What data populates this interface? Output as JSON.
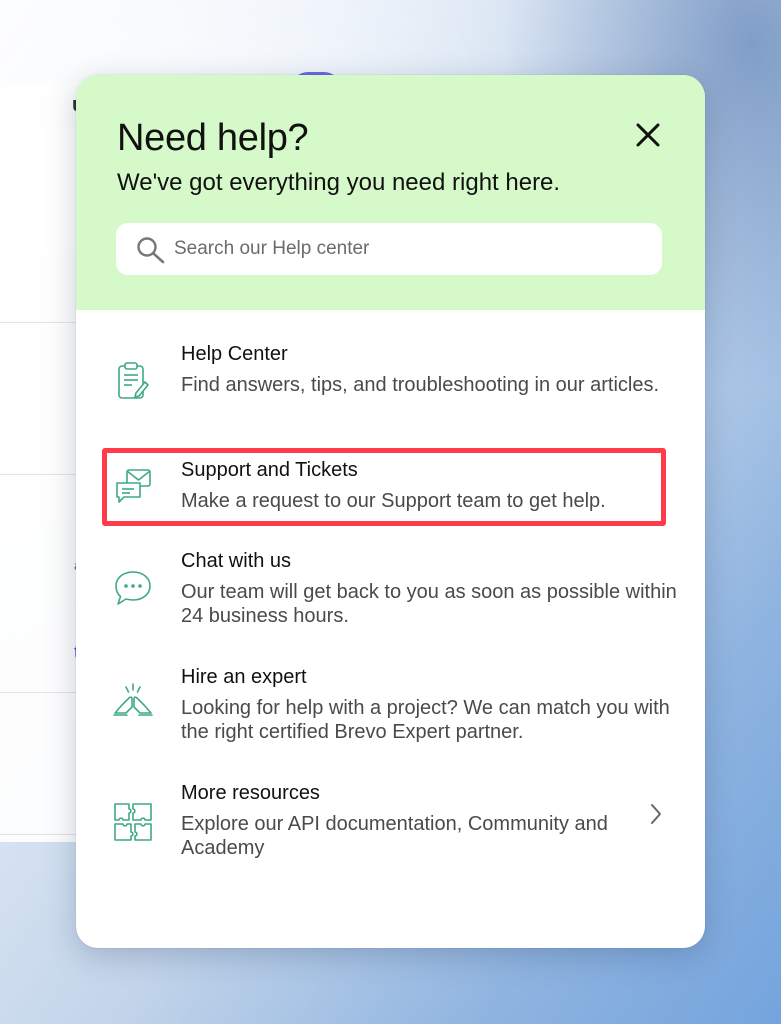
{
  "panel": {
    "title": "Need help?",
    "subtitle": "We've got everything you need right here.",
    "search": {
      "placeholder": "Search our Help center",
      "value": ""
    },
    "items": [
      {
        "icon": "clipboard-pencil-icon",
        "title": "Help Center",
        "description": "Find answers, tips, and troubleshooting in our articles."
      },
      {
        "icon": "envelope-chat-icon",
        "title": "Support and Tickets",
        "description": "Make a request to our Support team to get help."
      },
      {
        "icon": "chat-bubble-icon",
        "title": "Chat with us",
        "description": "Our team will get back to you as soon as possible within 24 business hours."
      },
      {
        "icon": "handshake-icon",
        "title": "Hire an expert",
        "description": "Looking for help with a project? We can match you with the right certified Brevo Expert partner."
      },
      {
        "icon": "puzzle-icon",
        "title": "More resources",
        "description": "Explore our API documentation, Community and Academy"
      }
    ]
  },
  "colors": {
    "header_bg": "#d5f9c8",
    "icon_green": "#3fa985",
    "highlight": "#ff3b4a"
  }
}
